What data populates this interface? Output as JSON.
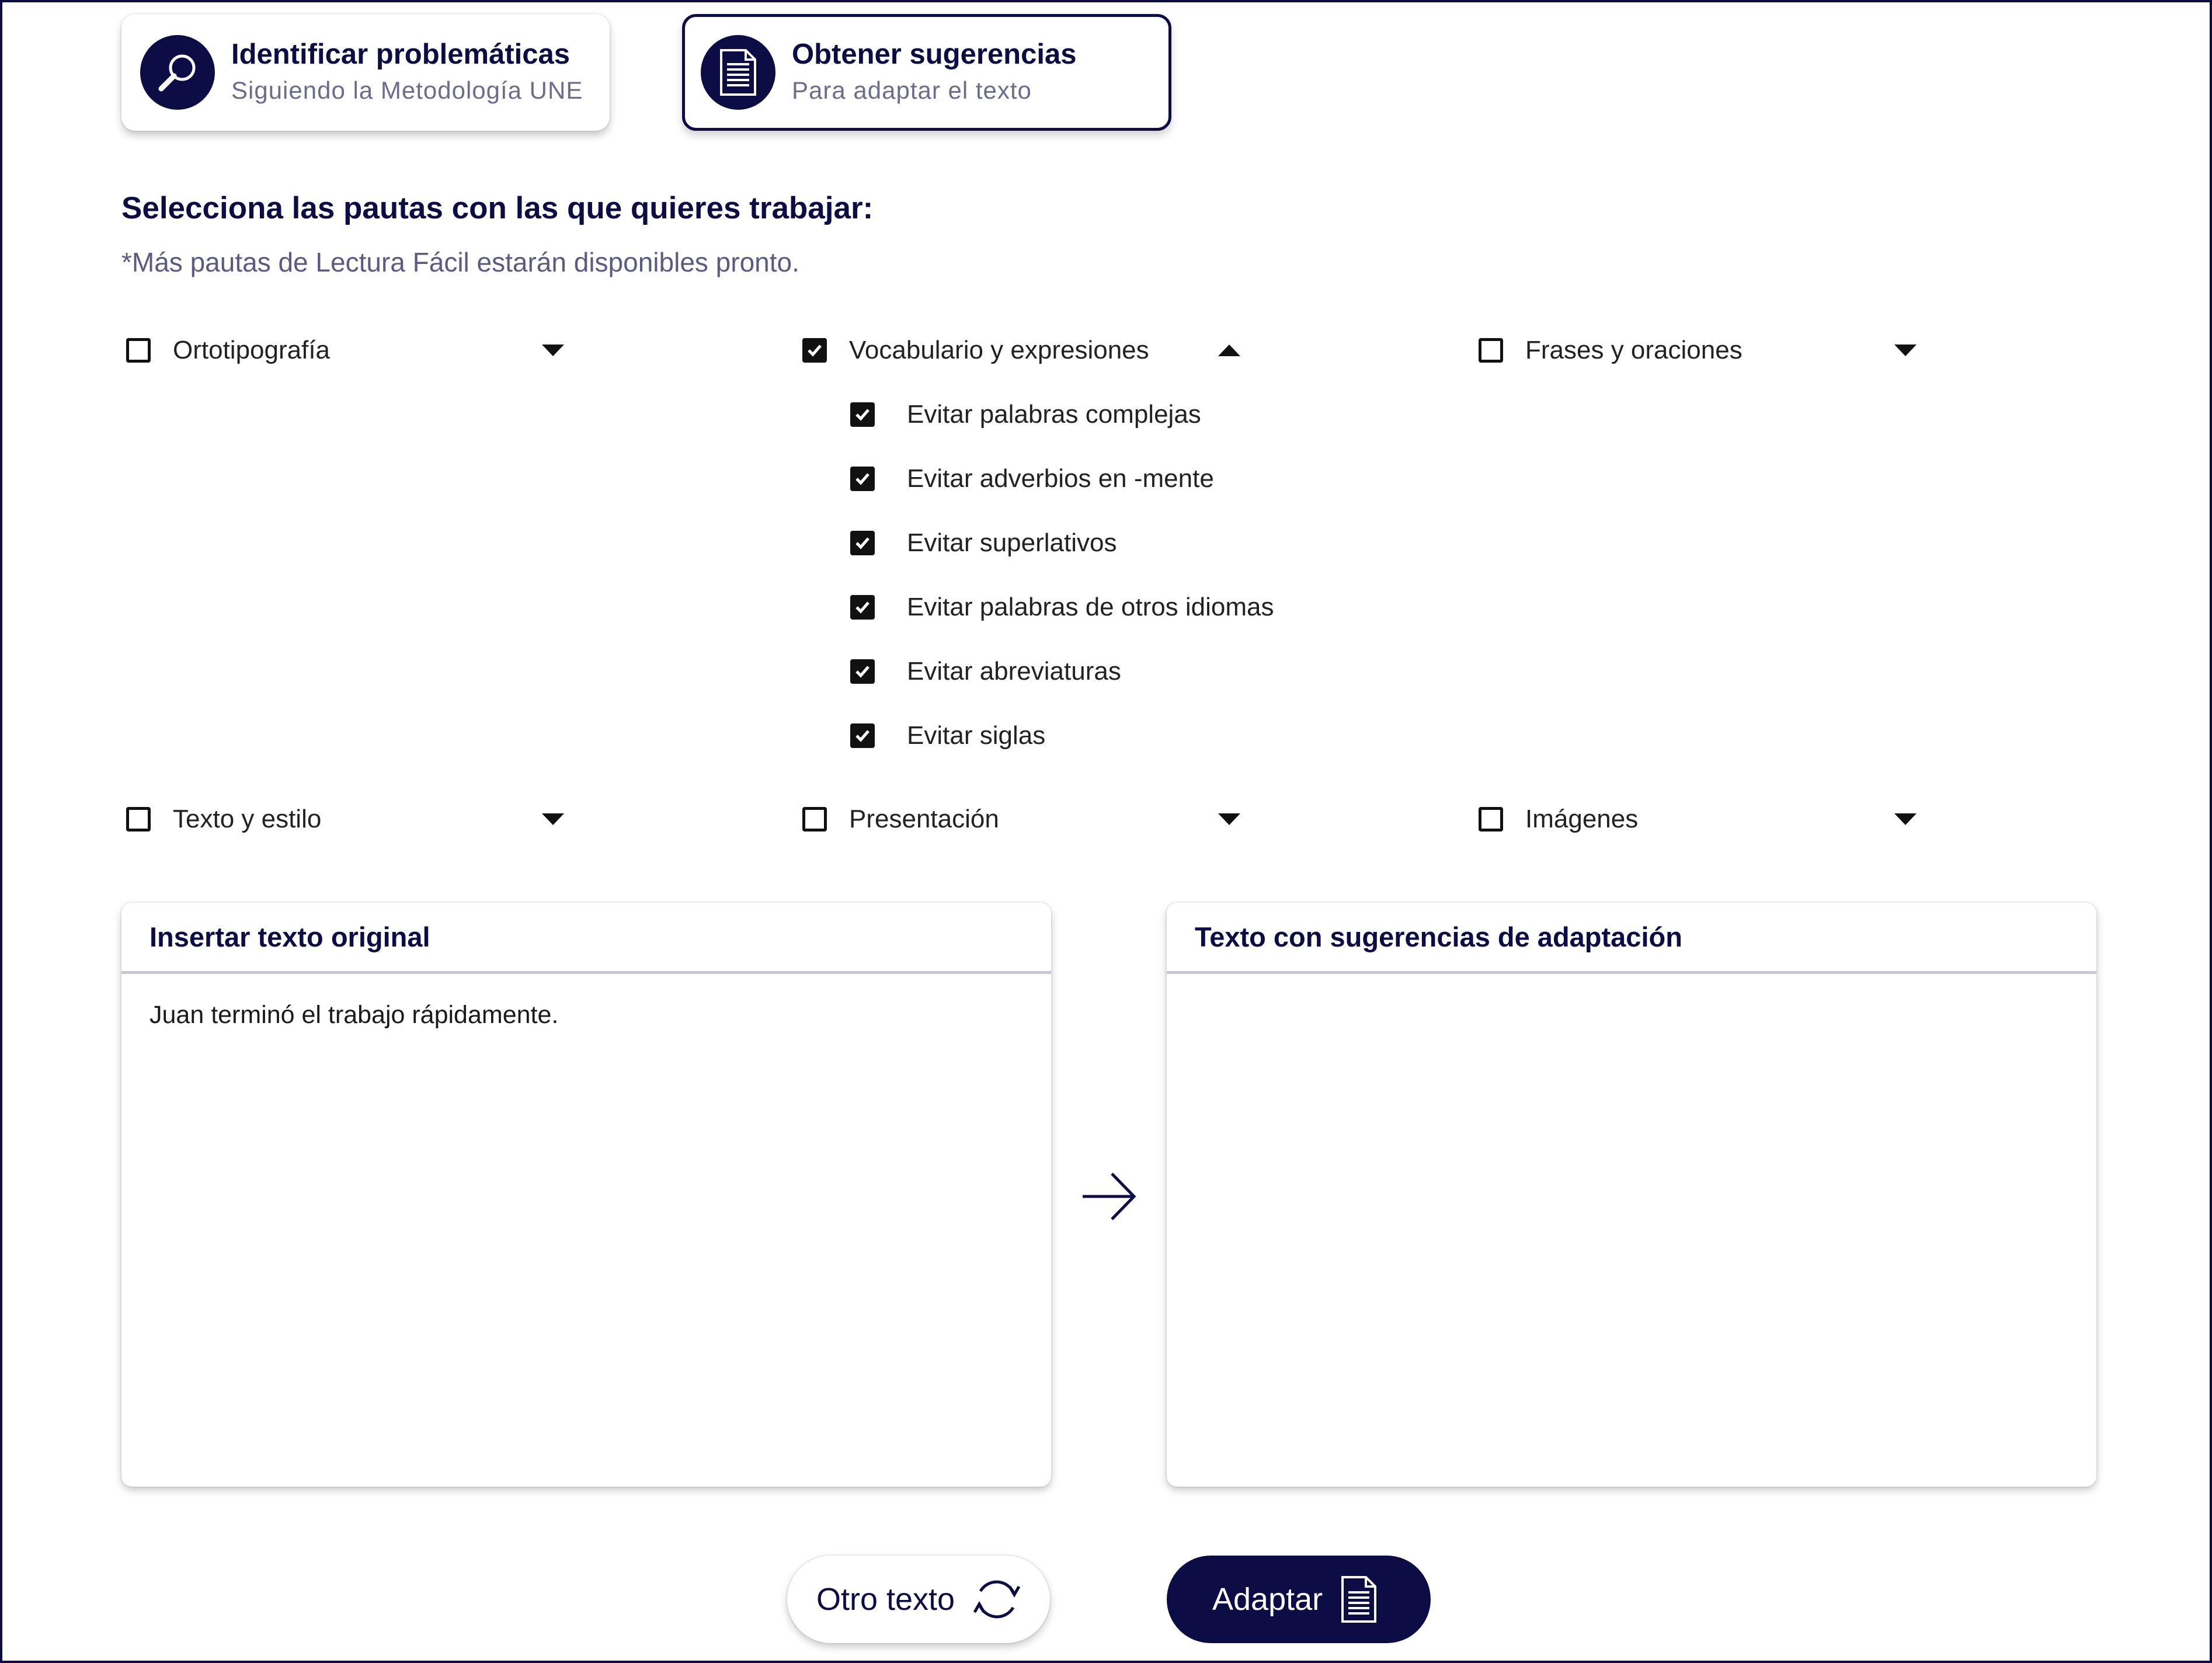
{
  "modes": [
    {
      "title": "Identificar problemáticas",
      "subtitle": "Siguiendo la Metodología UNE",
      "icon": "magnifier-icon",
      "active": false
    },
    {
      "title": "Obtener sugerencias",
      "subtitle": "Para adaptar el texto",
      "icon": "document-icon",
      "active": true
    }
  ],
  "guidelines": {
    "heading": "Selecciona las pautas con las que quieres trabajar:",
    "note": "*Más pautas de Lectura Fácil estarán disponibles pronto.",
    "groups": [
      {
        "label": "Ortotipografía",
        "checked": false,
        "expanded": false
      },
      {
        "label": "Vocabulario y expresiones",
        "checked": true,
        "expanded": true
      },
      {
        "label": "Frases y oraciones",
        "checked": false,
        "expanded": false
      },
      {
        "label": "Texto y estilo",
        "checked": false,
        "expanded": false
      },
      {
        "label": "Presentación",
        "checked": false,
        "expanded": false
      },
      {
        "label": "Imágenes",
        "checked": false,
        "expanded": false
      }
    ],
    "vocabulary_items": [
      {
        "label": "Evitar palabras complejas",
        "checked": true
      },
      {
        "label": "Evitar adverbios en -mente",
        "checked": true
      },
      {
        "label": "Evitar superlativos",
        "checked": true
      },
      {
        "label": "Evitar palabras de otros idiomas",
        "checked": true
      },
      {
        "label": "Evitar abreviaturas",
        "checked": true
      },
      {
        "label": "Evitar siglas",
        "checked": true
      }
    ]
  },
  "input_panel": {
    "title": "Insertar texto original",
    "text": "Juan terminó el trabajo rápidamente."
  },
  "output_panel": {
    "title": "Texto con sugerencias de adaptación",
    "text": ""
  },
  "buttons": {
    "other_text": "Otro texto",
    "adapt": "Adaptar"
  },
  "colors": {
    "primary": "#0d0d45",
    "muted": "#6c6c8c",
    "checkbox": "#111111"
  }
}
